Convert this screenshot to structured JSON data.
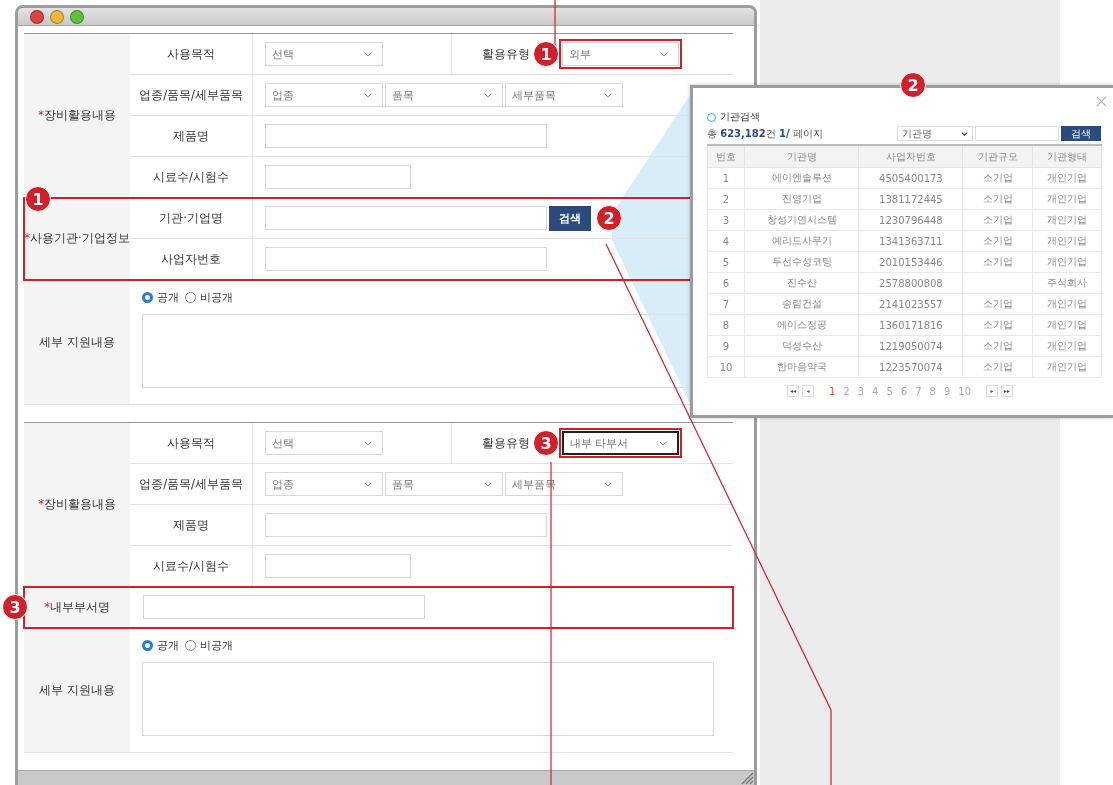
{
  "forms": [
    {
      "sections": [
        {
          "kind": "rows",
          "label": "장비활용내용",
          "mark": "*",
          "rows": [
            {
              "kind": "select-pair",
              "label": "사용목적",
              "select": "선택",
              "label2": "활용유형",
              "select2": "외부",
              "callout": "1",
              "focused": false
            },
            {
              "kind": "selects",
              "label": "업종/품목/세부품목",
              "selects": [
                "업종",
                "품목",
                "세부품목"
              ]
            },
            {
              "kind": "input",
              "label": "제품명"
            },
            {
              "kind": "input-short",
              "label": "시료수/시험수"
            }
          ]
        },
        {
          "kind": "rows",
          "label": "사용기관·기업정보",
          "mark": "*",
          "callout": "1",
          "rows": [
            {
              "kind": "input-search",
              "label": "기관·기업명",
              "button": "검색",
              "callout": "2"
            },
            {
              "kind": "input",
              "label": "사업자번호"
            }
          ]
        },
        {
          "kind": "textarea",
          "label": "세부 지원내용",
          "radios": [
            {
              "label": "공개",
              "selected": true
            },
            {
              "label": "비공개",
              "selected": false
            }
          ]
        }
      ]
    },
    {
      "sections": [
        {
          "kind": "rows",
          "label": "장비활용내용",
          "mark": "*",
          "rows": [
            {
              "kind": "select-pair",
              "label": "사용목적",
              "select": "선택",
              "label2": "활용유형",
              "select2": "내부 타부서",
              "callout": "3",
              "focused": true
            },
            {
              "kind": "selects",
              "label": "업종/품목/세부품목",
              "selects": [
                "업종",
                "품목",
                "세부품목"
              ]
            },
            {
              "kind": "input",
              "label": "제품명"
            },
            {
              "kind": "input-short",
              "label": "시료수/시험수"
            }
          ]
        },
        {
          "kind": "direct-input",
          "label": "내부부서명",
          "mark": "*",
          "callout": "3"
        },
        {
          "kind": "textarea",
          "label": "세부 지원내용",
          "radios": [
            {
              "label": "공개",
              "selected": true
            },
            {
              "label": "비공개",
              "selected": false
            }
          ]
        }
      ]
    }
  ],
  "popup": {
    "callout": "2",
    "title": "기관검색",
    "count": "총 **623,182**건 **1/** 페이지",
    "search_select": "기관명",
    "search_button": "검색",
    "columns": [
      "번호",
      "기관명",
      "사업자번호",
      "기관규모",
      "기관형태"
    ],
    "rows": [
      [
        "1",
        "에이엔솔루션",
        "4505400173",
        "소기업",
        "개인기업"
      ],
      [
        "2",
        "진영기업",
        "1381172445",
        "소기업",
        "개인기업"
      ],
      [
        "3",
        "창성기연시스템",
        "1230796448",
        "소기업",
        "개인기업"
      ],
      [
        "4",
        "예리드사무기",
        "1341363711",
        "소기업",
        "개인기업"
      ],
      [
        "5",
        "두선수성코팅",
        "2010153446",
        "소기업",
        "개인기업"
      ],
      [
        "6",
        "진수산",
        "2578800808",
        "",
        "주식회사"
      ],
      [
        "7",
        "송림건설",
        "2141023557",
        "소기업",
        "개인기업"
      ],
      [
        "8",
        "에이스정공",
        "1360171816",
        "소기업",
        "개인기업"
      ],
      [
        "9",
        "덕성수산",
        "1219050074",
        "소기업",
        "개인기업"
      ],
      [
        "10",
        "한마음약국",
        "1223570074",
        "소기업",
        "개인기업"
      ]
    ],
    "pages": [
      {
        "label": "1",
        "selected": true
      },
      {
        "label": "2",
        "selected": false
      },
      {
        "label": "3",
        "selected": false
      },
      {
        "label": "4",
        "selected": false
      },
      {
        "label": "5",
        "selected": false
      },
      {
        "label": "6",
        "selected": false
      },
      {
        "label": "7",
        "selected": false
      },
      {
        "label": "8",
        "selected": false
      },
      {
        "label": "9",
        "selected": false
      },
      {
        "label": "10",
        "selected": false
      }
    ]
  }
}
